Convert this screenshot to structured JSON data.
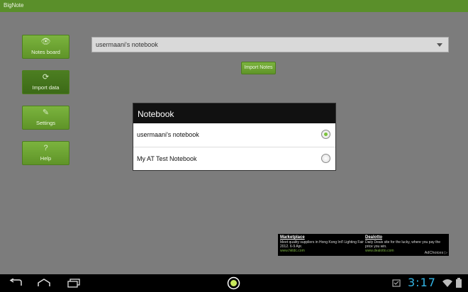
{
  "app": {
    "title": "BigNote"
  },
  "sidebar": {
    "items": [
      {
        "label": "Notes board",
        "icon": "eye-icon",
        "glyph": "👁"
      },
      {
        "label": "Import data",
        "icon": "refresh-icon",
        "glyph": "⟳"
      },
      {
        "label": "Settings",
        "icon": "wrench-icon",
        "glyph": "✎"
      },
      {
        "label": "Help",
        "icon": "question-icon",
        "glyph": "?"
      }
    ]
  },
  "main": {
    "notebook_select": "usermaani's notebook",
    "import_label": "Import Notes"
  },
  "dialog": {
    "title": "Notebook",
    "options": [
      {
        "label": "usermaani's notebook",
        "checked": true
      },
      {
        "label": "My AT Test Notebook",
        "checked": false
      }
    ]
  },
  "ads": [
    {
      "title": "Marketplace",
      "desc": "Meet quality suppliers in Hong Kong Int'l Lighting Fair 2012. 6-9 Apr.",
      "url": "www.hktdc.com"
    },
    {
      "title": "Dealotto",
      "desc": "Daily Deals site for the lucky, where you pay the price you win.",
      "url": "www.dealotto.com"
    }
  ],
  "ad_choices": "AdChoices ▷",
  "status": {
    "time": "3:17"
  },
  "colors": {
    "accent": "#5a8f2a",
    "clock": "#33b5e5"
  }
}
